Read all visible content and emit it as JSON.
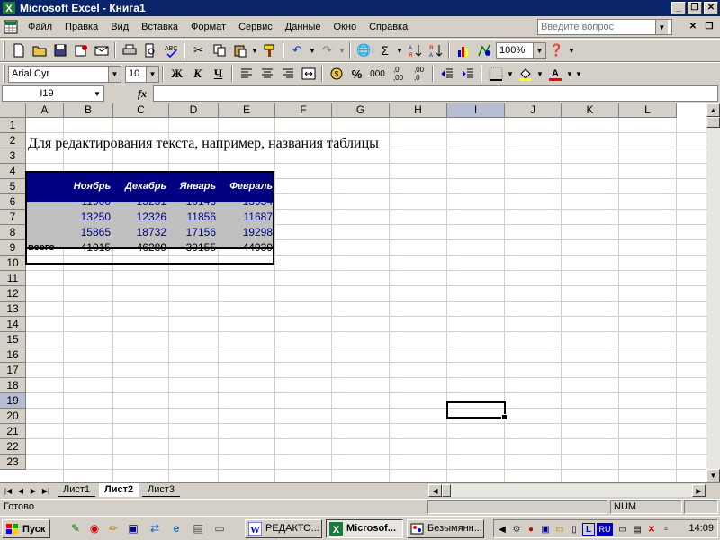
{
  "window": {
    "title": "Microsoft Excel - Книга1"
  },
  "menu": [
    "Файл",
    "Правка",
    "Вид",
    "Вставка",
    "Формат",
    "Сервис",
    "Данные",
    "Окно",
    "Справка"
  ],
  "help_placeholder": "Введите вопрос",
  "toolbar": {
    "zoom": "100%"
  },
  "format": {
    "font_name": "Arial Cyr",
    "font_size": "10",
    "bold": "Ж",
    "italic": "К",
    "underline": "Ч",
    "percent": "%",
    "thousands": "000"
  },
  "formula": {
    "name_box": "I19",
    "fx": "fx",
    "value": ""
  },
  "columns": [
    "A",
    "B",
    "C",
    "D",
    "E",
    "F",
    "G",
    "H",
    "I",
    "J",
    "K",
    "L"
  ],
  "rows": [
    "1",
    "2",
    "3",
    "4",
    "5",
    "6",
    "7",
    "8",
    "9",
    "10",
    "11",
    "12",
    "13",
    "14",
    "15",
    "16",
    "17",
    "18",
    "19",
    "20",
    "21",
    "22",
    "23"
  ],
  "sheet": {
    "title_text": "Для редактирования текста, например, названия таблицы",
    "months": [
      "Ноябрь",
      "Декабрь",
      "Январь",
      "Февраль"
    ],
    "data_rows": [
      [
        "11900",
        "15231",
        "10143",
        "13954"
      ],
      [
        "13250",
        "12326",
        "11856",
        "11687"
      ],
      [
        "15865",
        "18732",
        "17156",
        "19298"
      ]
    ],
    "total_label": "всего",
    "totals": [
      "41015",
      "46289",
      "39155",
      "44939"
    ]
  },
  "tabs": [
    "Лист1",
    "Лист2",
    "Лист3"
  ],
  "status": {
    "text": "Готово",
    "num": "NUM"
  },
  "taskbar": {
    "start": "Пуск",
    "tasks": [
      "РЕДАКТО...",
      "Microsof...",
      "Безымянн..."
    ],
    "lang": "RU",
    "clock": "14:09"
  },
  "colors": {
    "title_bar": "#0a246a",
    "table_header": "#000080",
    "table_body": "#c0c0c0",
    "number_text": "#000080",
    "selected_header": "#b6bdd2"
  }
}
